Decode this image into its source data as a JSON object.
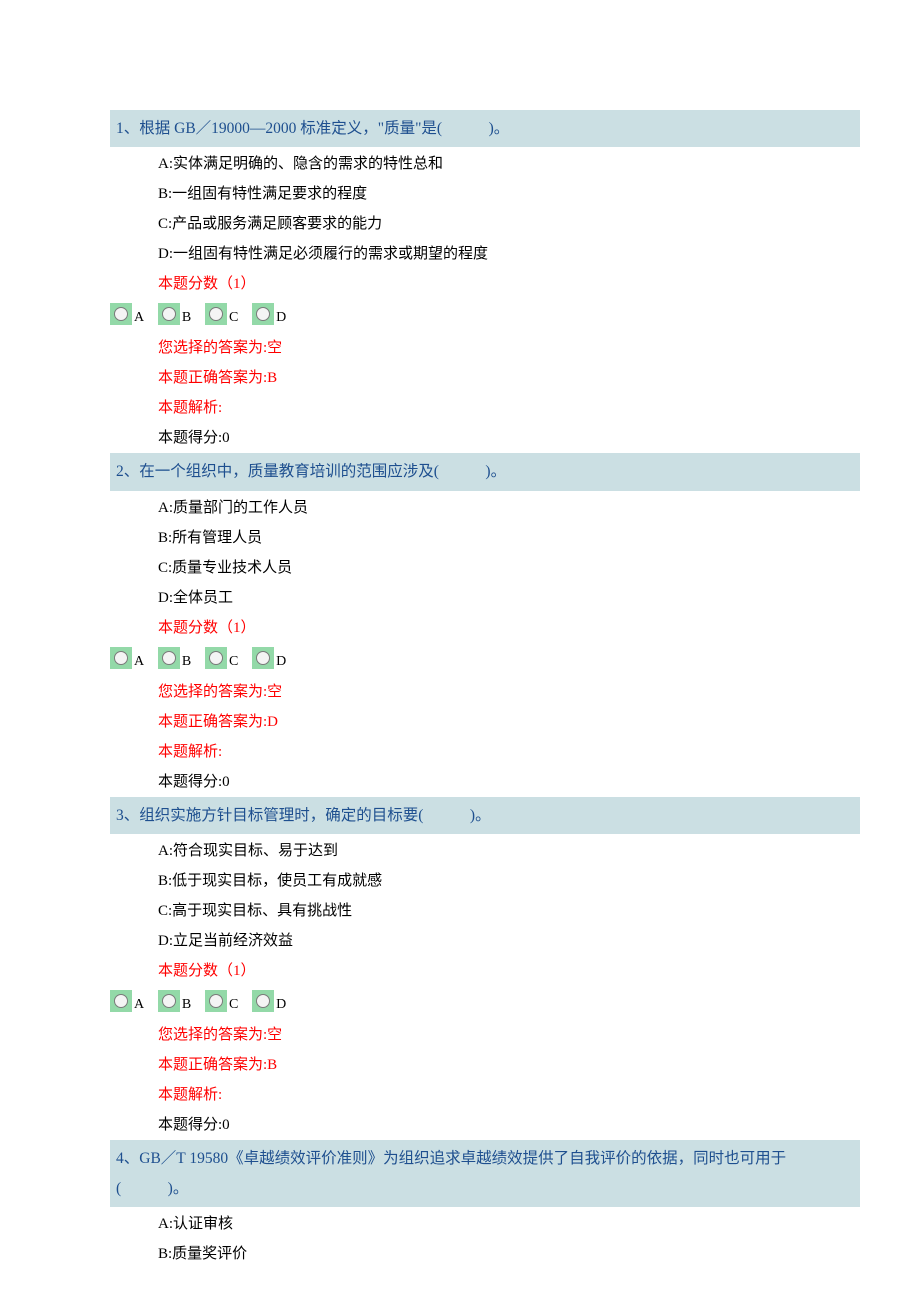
{
  "questions": [
    {
      "title": "1、根据 GB／19000—2000 标准定义，\"质量\"是(　　　)。",
      "options": {
        "A": "A:实体满足明确的、隐含的需求的特性总和",
        "B": "B:一组固有特性满足要求的程度",
        "C": "C:产品或服务满足顾客要求的能力",
        "D": "D:一组固有特性满足必须履行的需求或期望的程度"
      },
      "score_text": "本题分数（1）",
      "choices": {
        "A": "A",
        "B": "B",
        "C": "C",
        "D": "D"
      },
      "result": {
        "selected": "您选择的答案为:空",
        "correct": "本题正确答案为:B",
        "analysis": "本题解析:",
        "got": "本题得分:0"
      }
    },
    {
      "title": "2、在一个组织中，质量教育培训的范围应涉及(　　　)。",
      "options": {
        "A": "A:质量部门的工作人员",
        "B": "B:所有管理人员",
        "C": "C:质量专业技术人员",
        "D": "D:全体员工"
      },
      "score_text": "本题分数（1）",
      "choices": {
        "A": "A",
        "B": "B",
        "C": "C",
        "D": "D"
      },
      "result": {
        "selected": "您选择的答案为:空",
        "correct": "本题正确答案为:D",
        "analysis": "本题解析:",
        "got": "本题得分:0"
      }
    },
    {
      "title": "3、组织实施方针目标管理时，确定的目标要(　　　)。",
      "options": {
        "A": "A:符合现实目标、易于达到",
        "B": "B:低于现实目标，使员工有成就感",
        "C": "C:高于现实目标、具有挑战性",
        "D": "D:立足当前经济效益"
      },
      "score_text": "本题分数（1）",
      "choices": {
        "A": "A",
        "B": "B",
        "C": "C",
        "D": "D"
      },
      "result": {
        "selected": "您选择的答案为:空",
        "correct": "本题正确答案为:B",
        "analysis": "本题解析:",
        "got": "本题得分:0"
      }
    },
    {
      "title": "4、GB／T 19580《卓越绩效评价准则》为组织追求卓越绩效提供了自我评价的依据，同时也可用于(　　　)。",
      "options": {
        "A": "A:认证审核",
        "B": "B:质量奖评价"
      }
    }
  ]
}
